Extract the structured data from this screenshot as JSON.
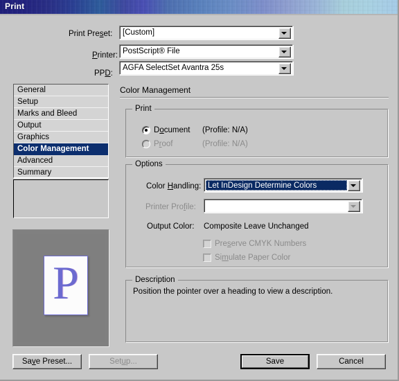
{
  "window": {
    "title": "Print"
  },
  "top_fields": [
    {
      "label_pre": "Print Pre",
      "label_accel": "s",
      "label_post": "et:",
      "value": "[Custom]",
      "name": "print-preset"
    },
    {
      "label_pre": "",
      "label_accel": "P",
      "label_post": "rinter:",
      "value": "PostScript® File",
      "name": "printer"
    },
    {
      "label_pre": "PP",
      "label_accel": "D",
      "label_post": ":",
      "value": "AGFA SelectSet Avantra 25s",
      "name": "ppd"
    }
  ],
  "sidebar": {
    "items": [
      {
        "label": "General",
        "selected": false
      },
      {
        "label": "Setup",
        "selected": false
      },
      {
        "label": "Marks and Bleed",
        "selected": false
      },
      {
        "label": "Output",
        "selected": false
      },
      {
        "label": "Graphics",
        "selected": false
      },
      {
        "label": "Color Management",
        "selected": true
      },
      {
        "label": "Advanced",
        "selected": false
      },
      {
        "label": "Summary",
        "selected": false
      }
    ]
  },
  "preview": {
    "page_letter": "P"
  },
  "panel": {
    "heading": "Color Management",
    "print_group": {
      "title": "Print",
      "document_label_pre": "D",
      "document_label_accel": "o",
      "document_label_post": "cument",
      "document_profile": "(Profile: N/A)",
      "proof_label_pre": "P",
      "proof_label_accel": "r",
      "proof_label_post": "oof",
      "proof_profile": "(Profile: N/A)"
    },
    "options_group": {
      "title": "Options",
      "color_handling_label_pre": "Color ",
      "color_handling_label_accel": "H",
      "color_handling_label_post": "andling:",
      "color_handling_value": "Let InDesign Determine Colors",
      "printer_profile_label_pre": "Printer Pro",
      "printer_profile_label_accel": "f",
      "printer_profile_label_post": "ile:",
      "printer_profile_value": "",
      "output_color_label": "Output Color:",
      "output_color_value": "Composite Leave Unchanged",
      "preserve_cmyk_pre": "Pre",
      "preserve_cmyk_accel": "s",
      "preserve_cmyk_post": "erve CMYK Numbers",
      "simulate_paper_pre": "Si",
      "simulate_paper_accel": "m",
      "simulate_paper_post": "ulate Paper Color"
    },
    "description_group": {
      "title": "Description",
      "text": "Position the pointer over a heading to view a description."
    }
  },
  "footer": {
    "save_preset_pre": "Sa",
    "save_preset_accel": "v",
    "save_preset_post": "e Preset...",
    "setup_pre": "Set",
    "setup_accel": "u",
    "setup_post": "p...",
    "save": "Save",
    "cancel": "Cancel"
  },
  "colors": {
    "dialog_face": "#c8c8c8",
    "selection_blue": "#0c2e6e",
    "combo_focus_blue": "#0a2a63",
    "disabled_text": "#8b8b8b",
    "preview_bg": "#808080",
    "preview_letter": "#6c6ad0"
  }
}
